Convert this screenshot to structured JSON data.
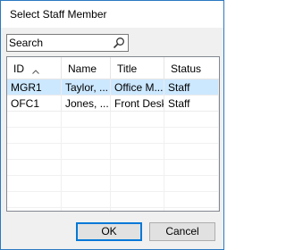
{
  "window": {
    "title": "Select Staff Member"
  },
  "search": {
    "placeholder": "Search",
    "value": "",
    "icon": "search-icon"
  },
  "table": {
    "columns": [
      "ID",
      "Name",
      "Title",
      "Status"
    ],
    "sort_column": "ID",
    "sort_direction": "ascending",
    "rows": [
      {
        "id": "MGR1",
        "name": "Taylor, ...",
        "title": "Office M...",
        "status": "Staff",
        "selected": true
      },
      {
        "id": "OFC1",
        "name": "Jones, ...",
        "title": "Front Desk",
        "status": "Staff",
        "selected": false
      }
    ]
  },
  "buttons": {
    "ok": "OK",
    "cancel": "Cancel"
  },
  "colors": {
    "selection": "#cce8ff",
    "accent": "#0078d7",
    "window_border": "#2b79c2"
  }
}
